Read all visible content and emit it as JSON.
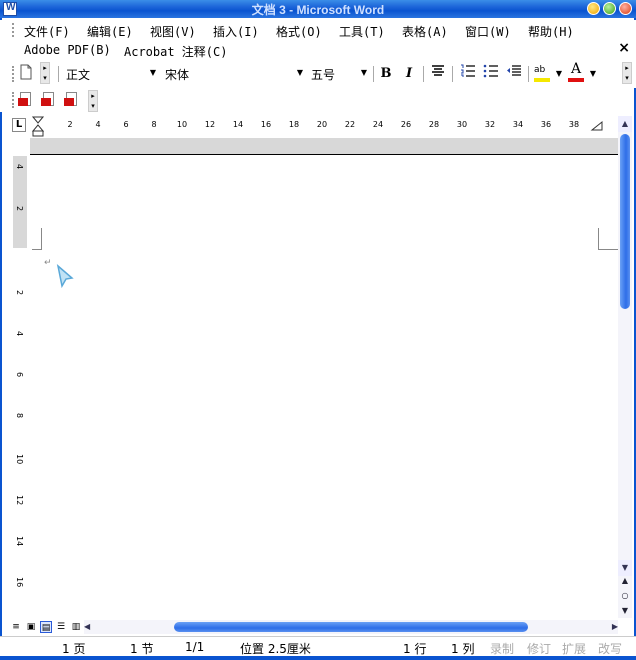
{
  "window": {
    "title": "文档 3 - Microsoft Word"
  },
  "menu": {
    "row1": [
      "文件(F)",
      "编辑(E)",
      "视图(V)",
      "插入(I)",
      "格式(O)",
      "工具(T)",
      "表格(A)",
      "窗口(W)",
      "帮助(H)"
    ],
    "row2": [
      "Adobe PDF(B)",
      "Acrobat 注释(C)"
    ],
    "close_doc": "×"
  },
  "toolbar": {
    "style": "正文",
    "font": "宋体",
    "size": "五号",
    "bold": "B",
    "italic": "I",
    "font_color_label": "A",
    "highlight_label": "ab",
    "font_color": "#e01010",
    "highlight_color": "#f5e800"
  },
  "ruler": {
    "ticks": [
      "2",
      "4",
      "6",
      "8",
      "10",
      "12",
      "14",
      "16",
      "18",
      "20",
      "22",
      "24",
      "26",
      "28",
      "30",
      "32",
      "34",
      "36",
      "38"
    ],
    "vticks_top": [
      "4",
      "2"
    ],
    "vticks": [
      "2",
      "4",
      "6",
      "8",
      "10",
      "12",
      "14",
      "16"
    ],
    "corner": "L"
  },
  "statusbar": {
    "page": "1 页",
    "section": "1 节",
    "page_of": "1/1",
    "position": "位置 2.5厘米",
    "line": "1 行",
    "column": "1 列",
    "rec": "录制",
    "trk": "修订",
    "ext": "扩展",
    "ovr": "改写"
  },
  "colors": {
    "titlebar": "#0a54d0",
    "scroll_thumb": "#2e6ee8"
  }
}
